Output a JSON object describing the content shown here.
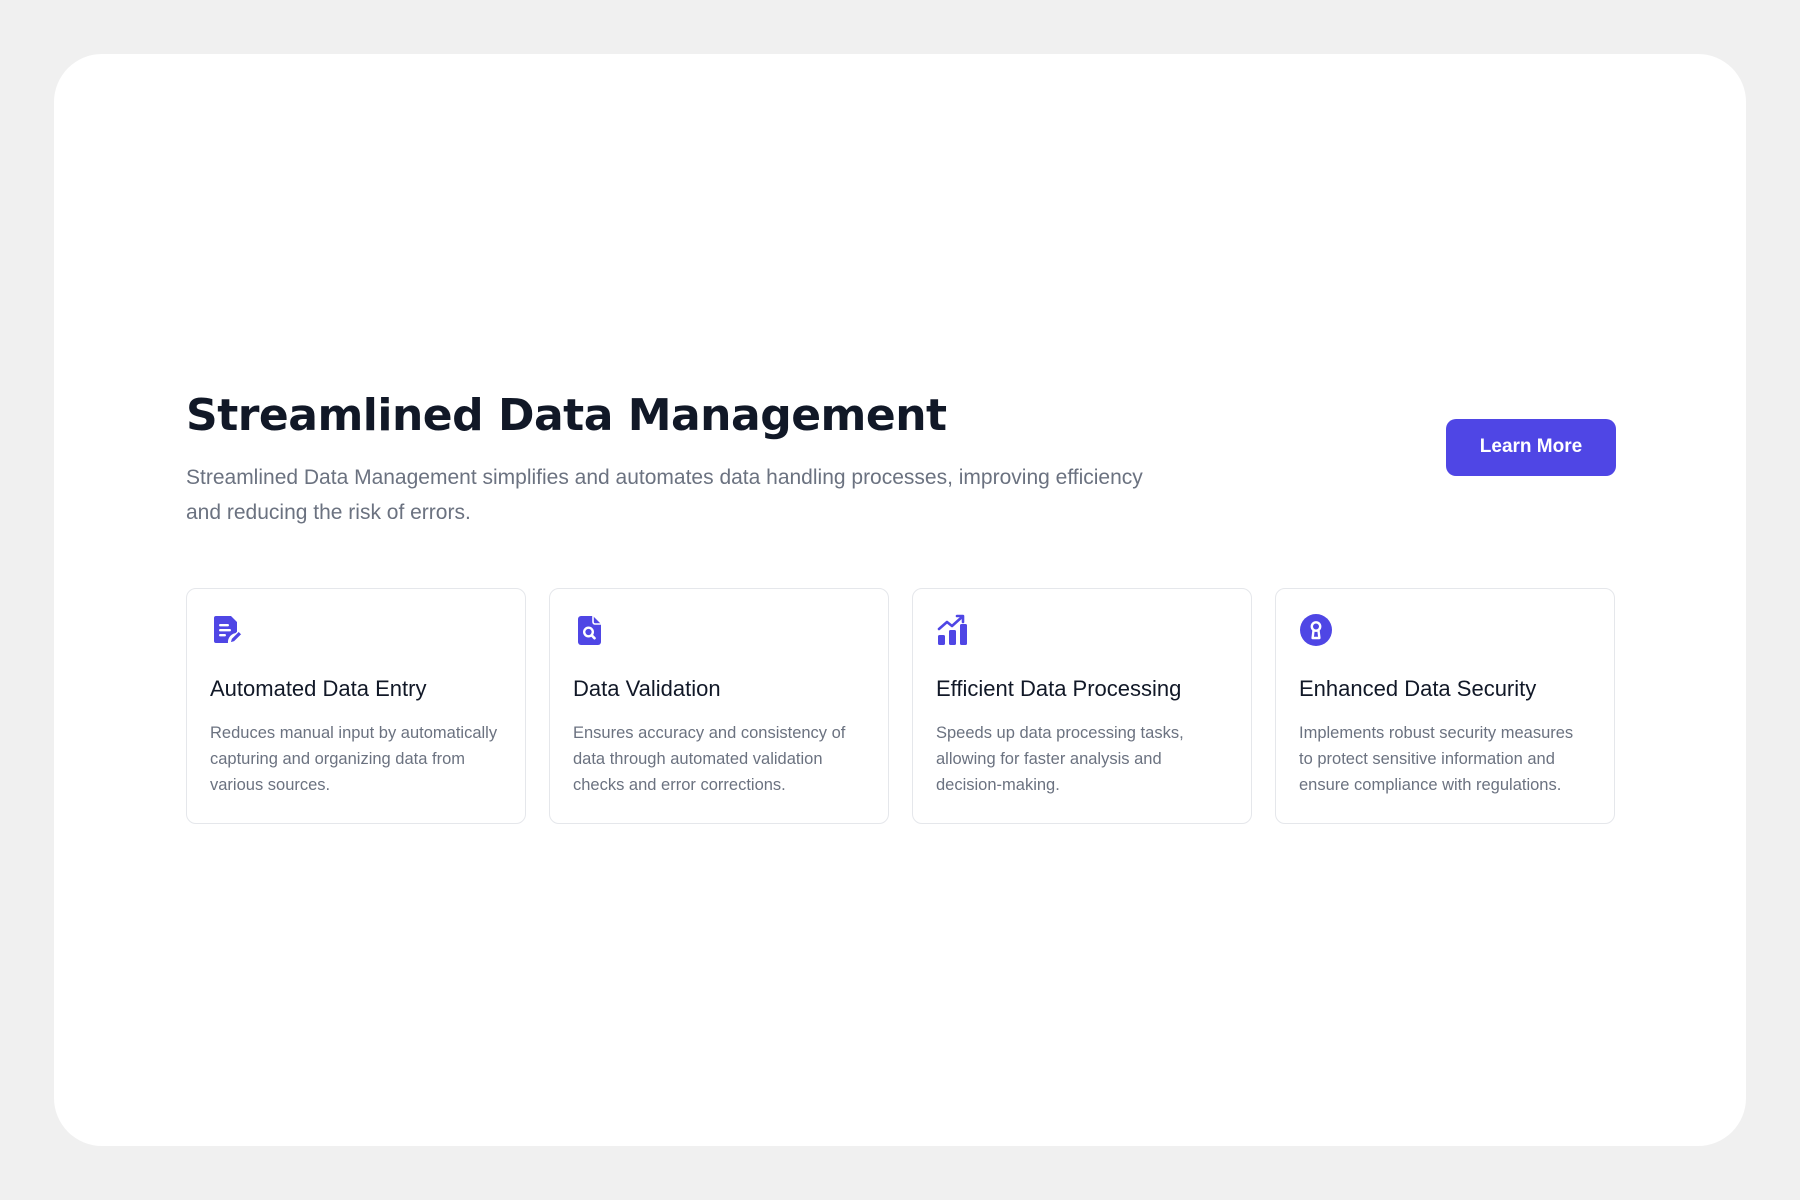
{
  "header": {
    "title": "Streamlined Data Management",
    "subtitle": "Streamlined Data Management simplifies and automates data handling processes, improving efficiency and reducing the risk of errors.",
    "cta_label": "Learn More"
  },
  "features": [
    {
      "icon": "document-edit-icon",
      "title": "Automated Data Entry",
      "description": "Reduces manual input by automatically capturing and organizing data from various sources."
    },
    {
      "icon": "document-search-icon",
      "title": "Data Validation",
      "description": "Ensures accuracy and consistency of data through automated validation checks and error corrections."
    },
    {
      "icon": "chart-growth-icon",
      "title": "Efficient Data Processing",
      "description": "Speeds up data processing tasks, allowing for faster analysis and decision-making."
    },
    {
      "icon": "keyhole-icon",
      "title": "Enhanced Data Security",
      "description": "Implements robust security measures to protect sensitive information and ensure compliance with regulations."
    }
  ],
  "colors": {
    "accent": "#4f46e5",
    "heading": "#111827",
    "muted": "#6b7280",
    "page_background": "#f0f0f0",
    "card_border": "#e5e7eb"
  }
}
